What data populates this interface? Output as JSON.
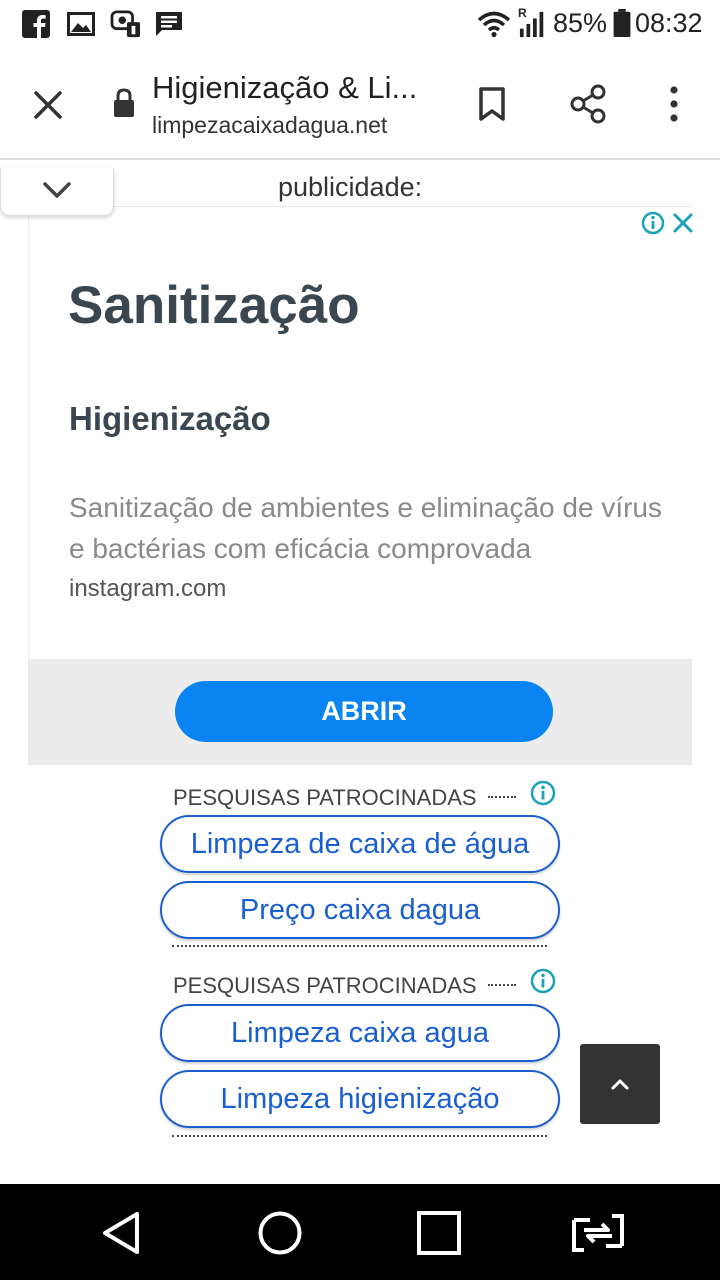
{
  "status_bar": {
    "icons": [
      "facebook-icon",
      "gallery-icon",
      "notification-icon",
      "message-icon",
      "wifi-icon",
      "signal-icon",
      "battery-icon"
    ],
    "signal_badge": "R",
    "battery": "85%",
    "time": "08:32"
  },
  "toolbar": {
    "title": "Higienização & Li...",
    "url": "limpezacaixadagua.net",
    "icons": [
      "close-icon",
      "lock-icon",
      "bookmark-icon",
      "share-icon",
      "more-vert-icon"
    ]
  },
  "ad": {
    "label": "publicidade:",
    "headline": "Sanitização",
    "subhead": "Higienização",
    "description": "Sanitização de ambientes e eliminação de vírus e bactérias com eficácia comprovada",
    "domain": "instagram.com",
    "cta": "ABRIR"
  },
  "sponsored": [
    {
      "header": "PESQUISAS PATROCINADAS",
      "items": [
        "Limpeza de caixa de água",
        "Preço caixa dagua"
      ]
    },
    {
      "header": "PESQUISAS PATROCINADAS",
      "items": [
        "Limpeza caixa agua",
        "Limpeza higienização"
      ]
    }
  ],
  "colors": {
    "accent": "#0a84f2",
    "link": "#1a5fd0",
    "info": "#1aa3b8",
    "headline": "#3b4750"
  }
}
